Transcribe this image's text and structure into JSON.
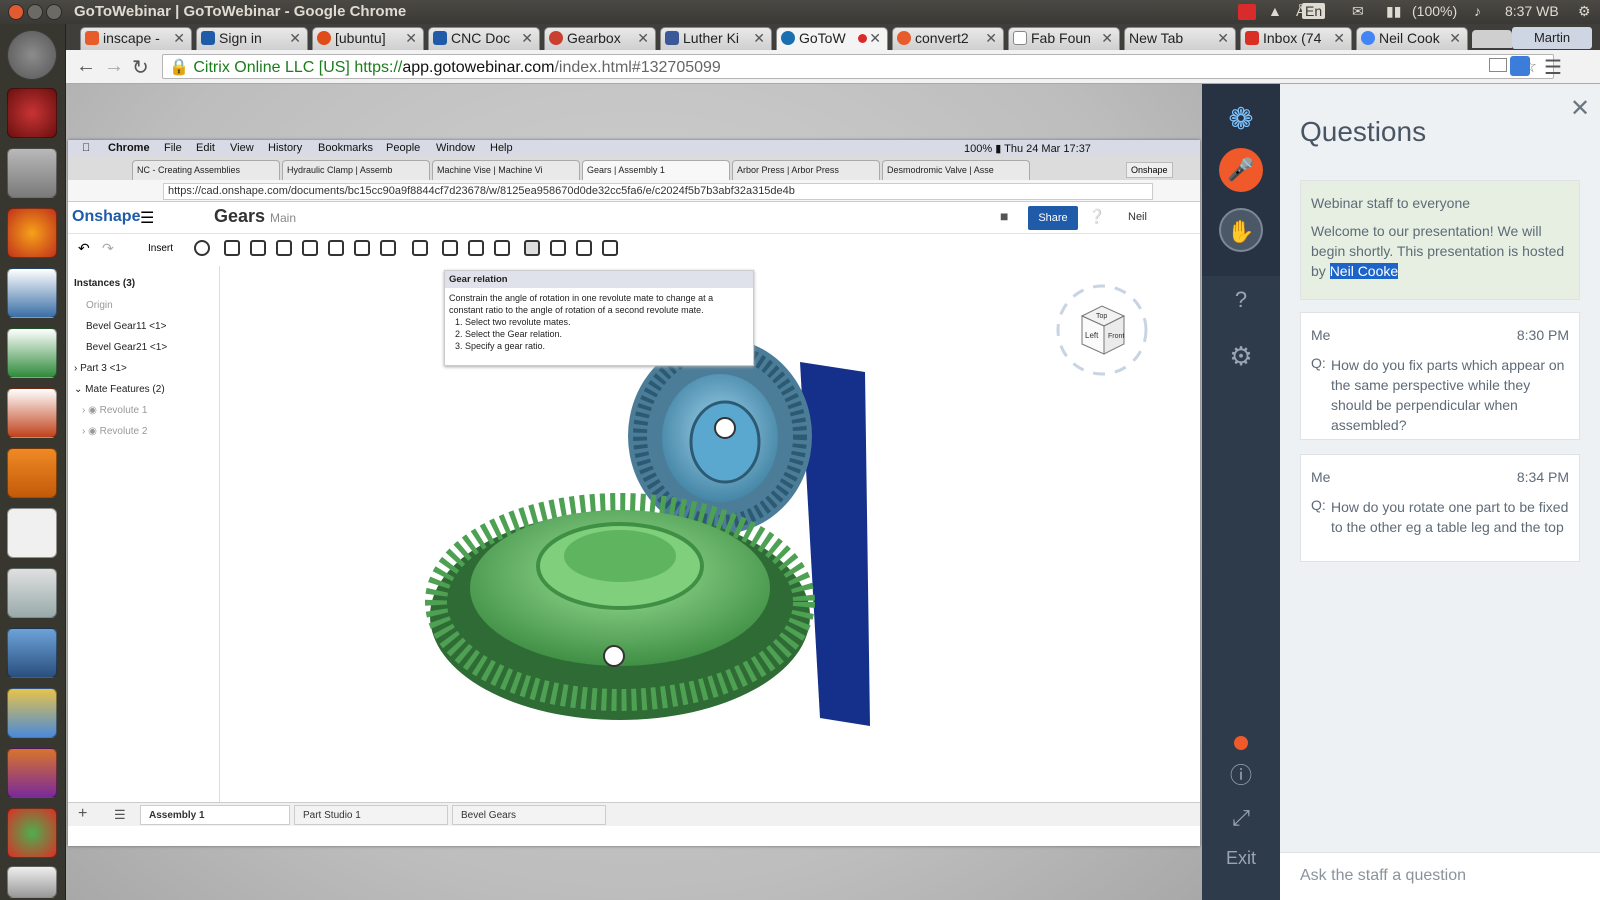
{
  "os": {
    "window_title": "GoToWebinar | GoToWebinar - Google Chrome",
    "tray": {
      "lang": "En",
      "battery": "(100%)",
      "clock": "8:37 WB"
    }
  },
  "browser": {
    "tabs": [
      {
        "label": "inscape -",
        "color": "#e85c2c"
      },
      {
        "label": "Sign in",
        "color": "#1f5ba8"
      },
      {
        "label": "[ubuntu]",
        "color": "#e04b1a"
      },
      {
        "label": "CNC Doc",
        "color": "#1f5ba8"
      },
      {
        "label": "Gearbox",
        "color": "#c9402f"
      },
      {
        "label": "Luther Ki",
        "color": "#3b5998"
      },
      {
        "label": "GoToW",
        "color": "#1a6fb0"
      },
      {
        "label": "convert2",
        "color": "#e85c2c"
      },
      {
        "label": "Fab Foun",
        "color": "#888888"
      },
      {
        "label": "New Tab",
        "color": "#cccccc"
      },
      {
        "label": "Inbox (74",
        "color": "#d93025"
      },
      {
        "label": "Neil Cook",
        "color": "#4285f4"
      }
    ],
    "profile": "Martin",
    "cert": "Citrix Online LLC [US]",
    "url_scheme": "https://",
    "url_host": "app.gotowebinar.com",
    "url_path": "/index.html#132705099"
  },
  "shared_screen": {
    "mac_menu": [
      "Chrome",
      "File",
      "Edit",
      "View",
      "History",
      "Bookmarks",
      "People",
      "Window",
      "Help"
    ],
    "mac_status": "100% ▮  Thu 24 Mar  17:37",
    "mac_tabs": [
      "NC - Creating Assemblies",
      "Hydraulic Clamp | Assemb",
      "Machine Vise | Machine Vi",
      "Gears | Assembly 1",
      "Arbor Press | Arbor Press",
      "Desmodromic Valve | Asse"
    ],
    "mac_profile": "Onshape",
    "mac_url": "https://cad.onshape.com/documents/bc15cc90a9f8844cf7d23678/w/8125ea958670d0de32cc5fa6/e/c2024f5b7b3abf32a315de4b",
    "onshape": {
      "logo": "Onshape",
      "doc_title": "Gears",
      "branch": "Main",
      "share": "Share",
      "user": "Neil",
      "insert": "Insert",
      "tree": [
        {
          "label": "Instances (3)",
          "bold": true
        },
        {
          "label": "Origin",
          "muted": true
        },
        {
          "label": "Bevel Gear11 <1>"
        },
        {
          "label": "Bevel Gear21 <1>"
        },
        {
          "label": "Part 3 <1>"
        },
        {
          "label": "Mate Features (2)"
        },
        {
          "label": "Revolute 1",
          "muted": true
        },
        {
          "label": "Revolute 2",
          "muted": true
        }
      ],
      "tooltip_title": "Gear relation",
      "tooltip_body": "Constrain the angle of rotation in one revolute mate to change at a constant ratio to the angle of rotation of a second revolute mate.",
      "tooltip_steps": [
        "1. Select two revolute mates.",
        "2. Select the Gear relation.",
        "3. Specify a gear ratio."
      ],
      "bottom_tabs": [
        "Assembly 1",
        "Part Studio 1",
        "Bevel Gears"
      ],
      "viewcube": {
        "top": "Top",
        "front": "Left",
        "right": "Front"
      }
    }
  },
  "webinar": {
    "panel_title": "Questions",
    "messages": [
      {
        "from": "Webinar staff to everyone",
        "time": "",
        "prefix": "",
        "text": "Welcome to our presentation! We will begin shortly. This presentation is hosted by ",
        "highlight": "Neil Cooke",
        "staff": true
      },
      {
        "from": "Me",
        "time": "8:30 PM",
        "prefix": "Q:",
        "text": "How do you fix parts which appear on the same perspective while they should be perpendicular when assembled?"
      },
      {
        "from": "Me",
        "time": "8:34 PM",
        "prefix": "Q:",
        "text": "How do you rotate one part to be fixed to the other eg a table leg and the top"
      }
    ],
    "ask_placeholder": "Ask the staff a question",
    "exit": "Exit",
    "colors": {
      "mic": "#f0592a",
      "rail": "#2e3b4b",
      "staff_card": "#e6efe2"
    }
  }
}
